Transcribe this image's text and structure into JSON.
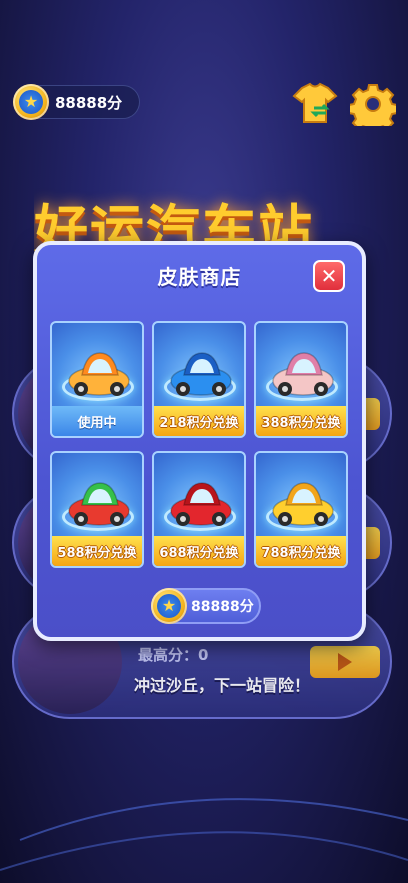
{
  "top_bar": {
    "coins": "88888分",
    "shirt_icon": "shirt-swap-icon",
    "settings_icon": "gear-icon"
  },
  "background": {
    "title": "好运汽车站",
    "card3_score": "最高分：0",
    "card3_desc": "冲过沙丘，下一站冒险！"
  },
  "modal": {
    "title": "皮肤商店",
    "close_label": "✕",
    "coins": "88888分",
    "skins": [
      {
        "car": "orange-car",
        "body": "#ffb23a",
        "roof": "#ff8a1f",
        "label": "使用中",
        "state": "in-use"
      },
      {
        "car": "blue-beetle",
        "body": "#2b8ff0",
        "roof": "#1b5fc4",
        "label": "218积分兑换",
        "state": "buy"
      },
      {
        "car": "pink-car",
        "body": "#f4c6c6",
        "roof": "#e07fa8",
        "label": "388积分兑换",
        "state": "buy"
      },
      {
        "car": "block-car",
        "body": "#e83a2f",
        "roof": "#36c04a",
        "label": "588积分兑换",
        "state": "buy"
      },
      {
        "car": "red-car",
        "body": "#e3262d",
        "roof": "#b8141b",
        "label": "688积分兑换",
        "state": "buy"
      },
      {
        "car": "yellow-car",
        "body": "#ffcf2e",
        "roof": "#f2a51b",
        "label": "788积分兑换",
        "state": "buy"
      }
    ]
  },
  "colors": {
    "accent_yellow": "#ffd84a",
    "modal_blue": "#5e6be8",
    "close_red": "#e02f3c"
  }
}
